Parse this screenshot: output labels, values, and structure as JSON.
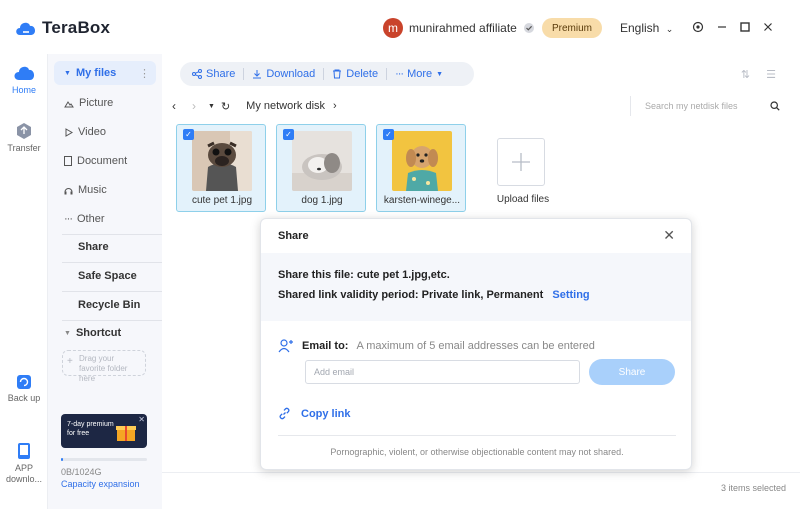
{
  "app": {
    "name": "TeraBox"
  },
  "header": {
    "avatar_letter": "m",
    "username": "munirahmed affiliate",
    "premium_label": "Premium",
    "language": "English"
  },
  "rail": {
    "items": [
      {
        "label": "Home",
        "icon": "cloud-icon"
      },
      {
        "label": "Transfer",
        "icon": "transfer-icon"
      },
      {
        "label": "Back up",
        "icon": "backup-icon"
      },
      {
        "label": "APP downlo...",
        "icon": "app-download-icon"
      }
    ]
  },
  "sidebar": {
    "my_files": "My files",
    "items": [
      {
        "label": "Picture",
        "icon": "picture-icon"
      },
      {
        "label": "Video",
        "icon": "video-icon"
      },
      {
        "label": "Document",
        "icon": "document-icon"
      },
      {
        "label": "Music",
        "icon": "music-icon"
      },
      {
        "label": "Other",
        "icon": "other-icon"
      }
    ],
    "share": "Share",
    "safe_space": "Safe Space",
    "recycle_bin": "Recycle Bin",
    "shortcut": "Shortcut",
    "drag_hint": "Drag your favorite folder here",
    "promo_text": "7-day premium for free",
    "capacity": "0B/1024G",
    "capacity_used_fraction": 0.02,
    "capacity_link": "Capacity expansion"
  },
  "toolbar": {
    "share": "Share",
    "download": "Download",
    "delete": "Delete",
    "more": "More"
  },
  "nav": {
    "path": "My network disk",
    "search_placeholder": "Search my netdisk files"
  },
  "files": [
    {
      "name": "cute pet 1.jpg",
      "checked": "✓"
    },
    {
      "name": "dog 1.jpg",
      "checked": "✓"
    },
    {
      "name": "karsten-winege...",
      "checked": "✓"
    }
  ],
  "upload": {
    "label": "Upload files"
  },
  "status": {
    "selected": "3 items selected"
  },
  "dialog": {
    "title": "Share",
    "share_file": "Share this file: cute pet 1.jpg,etc.",
    "validity": "Shared link validity period: Private link, Permanent",
    "setting_link": "Setting",
    "email_label": "Email to:",
    "email_hint": "A maximum of 5 email addresses can be entered",
    "email_placeholder": "Add email",
    "share_button": "Share",
    "copy_link": "Copy link",
    "disclaimer": "Pornographic, violent, or otherwise objectionable content may not shared."
  },
  "colors": {
    "accent": "#2f7df6",
    "premium_bg": "#f8dca9",
    "share_button_bg": "#a9d0fb",
    "selected_card_bg": "#e3f2fb"
  }
}
